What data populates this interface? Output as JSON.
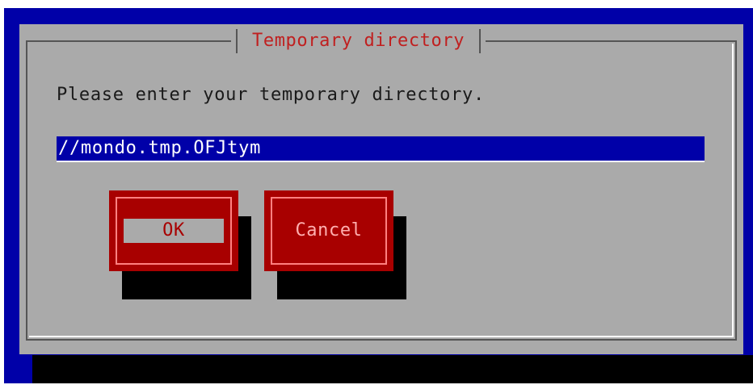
{
  "dialog": {
    "title": "Temporary directory",
    "prompt": "Please enter your temporary directory.",
    "input_value": "//mondo.tmp.OFJtym"
  },
  "buttons": {
    "ok_label": "OK",
    "cancel_label": "Cancel"
  },
  "colors": {
    "screen_background": "#0000a8",
    "dialog_background": "#aaaaaa",
    "title_text": "#c02020",
    "button_background": "#a80000",
    "input_background": "#0000a8",
    "shadow": "#000000"
  }
}
